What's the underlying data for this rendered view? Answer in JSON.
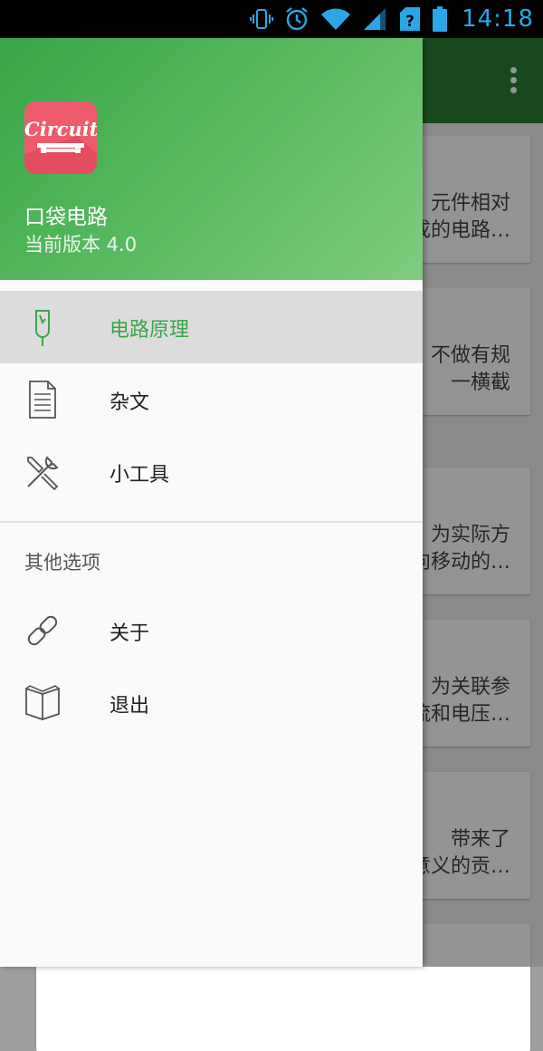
{
  "status_bar": {
    "time": "14:18",
    "icons": [
      "vibrate-icon",
      "alarm-icon",
      "wifi-icon",
      "signal-icon",
      "no-sim-icon",
      "battery-icon"
    ],
    "color": "#2aa7e6"
  },
  "drawer": {
    "header": {
      "logo_text": "Circuit",
      "app_name": "口袋电路",
      "version": "当前版本 4.0",
      "gradient": [
        "#39a548",
        "#7fcc80"
      ]
    },
    "main_items": [
      {
        "label": "电路原理",
        "icon": "circuit-probe-icon",
        "active": true
      },
      {
        "label": "杂文",
        "icon": "document-icon",
        "active": false
      },
      {
        "label": "小工具",
        "icon": "tools-icon",
        "active": false
      }
    ],
    "section_title": "其他选项",
    "other_items": [
      {
        "label": "关于",
        "icon": "link-icon"
      },
      {
        "label": "退出",
        "icon": "book-icon"
      }
    ],
    "accent_color": "#3aa64a"
  },
  "background": {
    "cards": [
      {
        "text": "元件相对\n成的电路…"
      },
      {
        "text": "不做有规\n一横截"
      },
      {
        "text": "为实际方\n向移动的…"
      },
      {
        "text": "为关联参\n流和电压…"
      },
      {
        "text": "带来了\n意义的贡…"
      },
      {
        "text": ""
      }
    ]
  }
}
